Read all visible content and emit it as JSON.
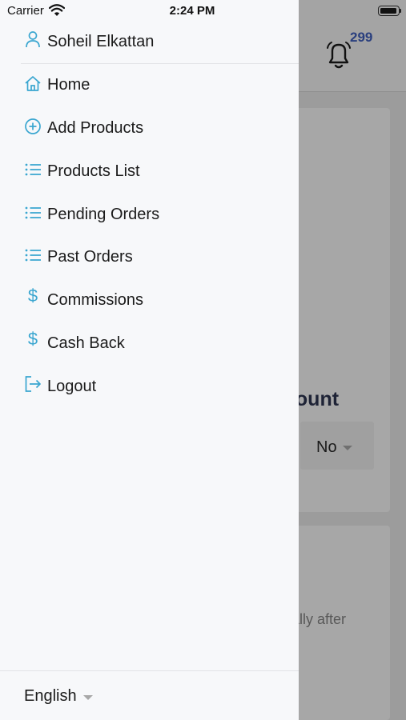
{
  "status_bar": {
    "carrier": "Carrier",
    "time": "2:24 PM"
  },
  "background": {
    "notification_count": "299",
    "card_title_fragment": "count",
    "select_value": "No",
    "card_text_fragment": "cally after"
  },
  "drawer": {
    "user": {
      "name": "Soheil Elkattan",
      "icon": "user-icon"
    },
    "items": [
      {
        "label": "Home",
        "icon": "home-icon"
      },
      {
        "label": "Add Products",
        "icon": "plus-circle-icon"
      },
      {
        "label": "Products List",
        "icon": "list-icon"
      },
      {
        "label": "Pending Orders",
        "icon": "list-icon"
      },
      {
        "label": "Past Orders",
        "icon": "list-icon"
      },
      {
        "label": "Commissions",
        "icon": "dollar-icon"
      },
      {
        "label": "Cash Back",
        "icon": "dollar-icon"
      },
      {
        "label": "Logout",
        "icon": "logout-icon"
      }
    ],
    "language": "English"
  },
  "colors": {
    "accent": "#3aa6d0",
    "text": "#1b1b1b",
    "drawer_bg": "#f7f8fa",
    "badge": "#2a3f7e"
  }
}
